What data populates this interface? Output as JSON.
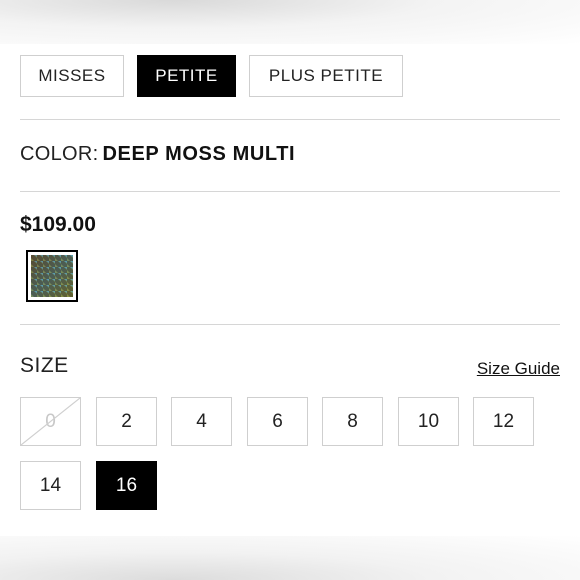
{
  "fit_tabs": [
    {
      "label": "MISSES",
      "selected": false
    },
    {
      "label": "PETITE",
      "selected": true
    },
    {
      "label": "PLUS PETITE",
      "selected": false
    }
  ],
  "color": {
    "label": "COLOR:",
    "value": "DEEP MOSS MULTI"
  },
  "price": "$109.00",
  "swatch": {
    "name": "deep-moss-multi",
    "colors": [
      "#5a5030",
      "#4a8fa6",
      "#8a9a3a",
      "#6a5a40"
    ]
  },
  "size": {
    "label": "SIZE",
    "guide_label": "Size Guide",
    "options": [
      {
        "label": "0",
        "state": "unavailable"
      },
      {
        "label": "2",
        "state": "available"
      },
      {
        "label": "4",
        "state": "available"
      },
      {
        "label": "6",
        "state": "available"
      },
      {
        "label": "8",
        "state": "available"
      },
      {
        "label": "10",
        "state": "available"
      },
      {
        "label": "12",
        "state": "available"
      },
      {
        "label": "14",
        "state": "available"
      },
      {
        "label": "16",
        "state": "selected"
      }
    ]
  },
  "colors": {
    "selected_bg": "#000000",
    "border": "#cfcfcf",
    "divider": "#d6d6d6"
  }
}
